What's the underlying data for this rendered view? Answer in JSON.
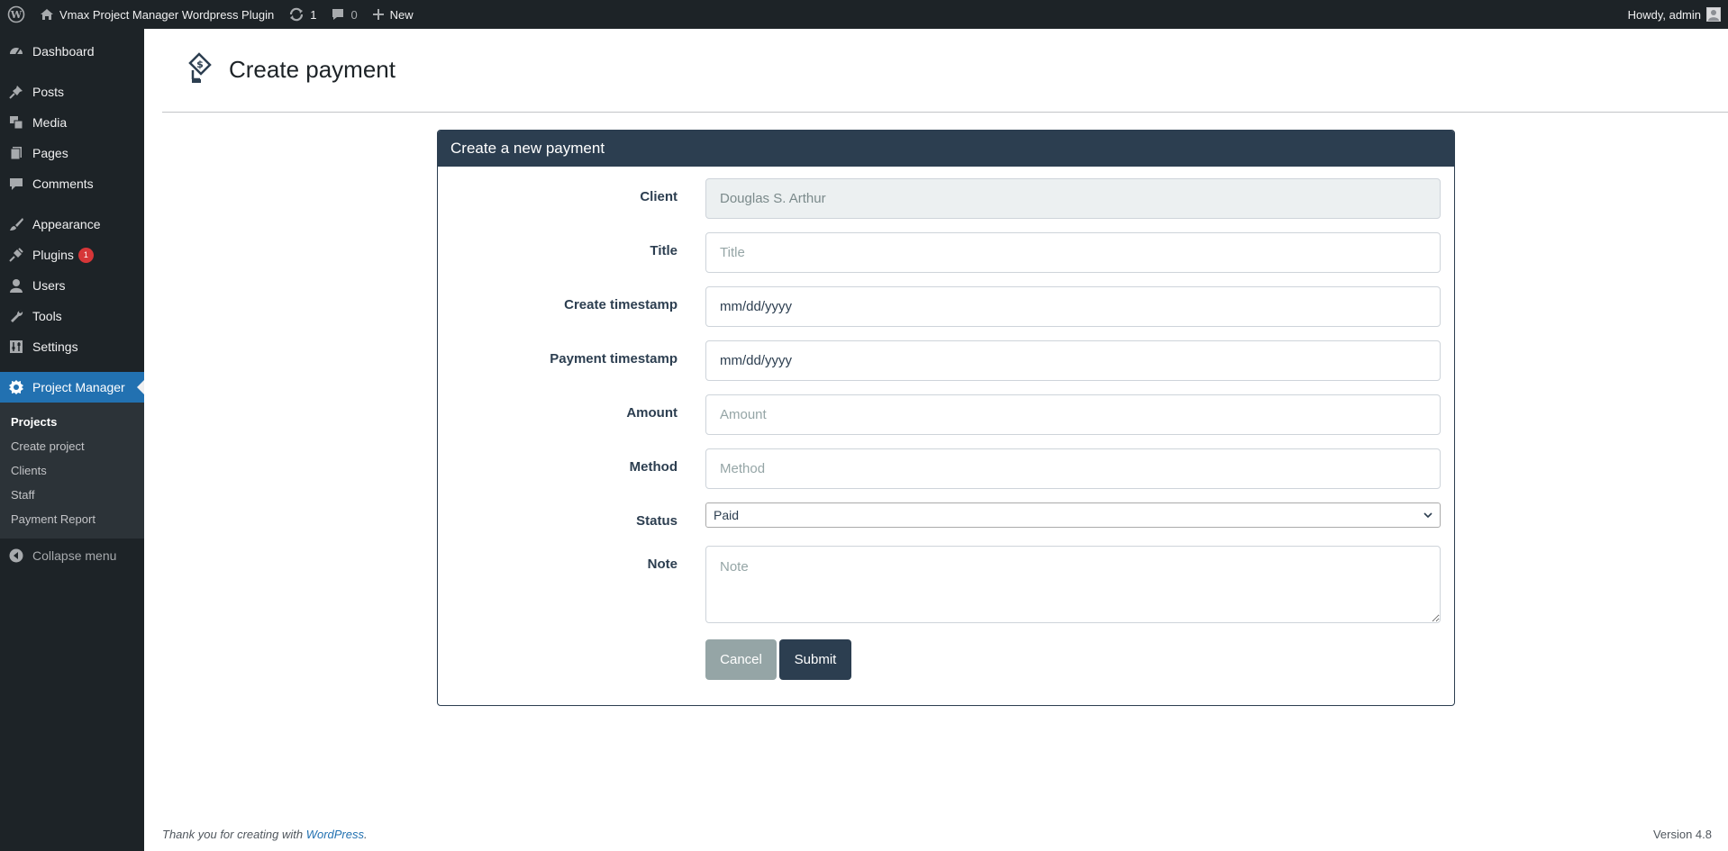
{
  "adminbar": {
    "site_name": "Vmax Project Manager Wordpress Plugin",
    "updates_count": "1",
    "comments_count": "0",
    "new_label": "New",
    "howdy": "Howdy, admin"
  },
  "sidebar": {
    "items": [
      {
        "label": "Dashboard",
        "icon": "dashboard-icon"
      },
      {
        "label": "Posts",
        "icon": "pin-icon"
      },
      {
        "label": "Media",
        "icon": "media-icon"
      },
      {
        "label": "Pages",
        "icon": "pages-icon"
      },
      {
        "label": "Comments",
        "icon": "comment-icon"
      },
      {
        "label": "Appearance",
        "icon": "brush-icon"
      },
      {
        "label": "Plugins",
        "icon": "plug-icon",
        "badge": "1"
      },
      {
        "label": "Users",
        "icon": "user-icon"
      },
      {
        "label": "Tools",
        "icon": "wrench-icon"
      },
      {
        "label": "Settings",
        "icon": "settings-icon"
      },
      {
        "label": "Project Manager",
        "icon": "gear-icon"
      }
    ],
    "submenu": [
      "Projects",
      "Create project",
      "Clients",
      "Staff",
      "Payment Report"
    ],
    "collapse_label": "Collapse menu"
  },
  "page": {
    "title": "Create payment"
  },
  "form": {
    "header": "Create a new payment",
    "client_label": "Client",
    "client_value": "Douglas S. Arthur",
    "title_label": "Title",
    "title_placeholder": "Title",
    "create_ts_label": "Create timestamp",
    "create_ts_placeholder": "mm/dd/yyyy",
    "payment_ts_label": "Payment timestamp",
    "payment_ts_placeholder": "mm/dd/yyyy",
    "amount_label": "Amount",
    "amount_placeholder": "Amount",
    "method_label": "Method",
    "method_placeholder": "Method",
    "status_label": "Status",
    "status_value": "Paid",
    "note_label": "Note",
    "note_placeholder": "Note",
    "cancel_label": "Cancel",
    "submit_label": "Submit"
  },
  "footer": {
    "thanks_prefix": "Thank you for creating with ",
    "wordpress_link": "WordPress",
    "thanks_suffix": ".",
    "version": "Version 4.8"
  },
  "colors": {
    "admin_dark": "#1d2327",
    "accent_blue": "#2271b1",
    "card_header": "#2c3e50",
    "cancel_button": "#95a5a6"
  }
}
